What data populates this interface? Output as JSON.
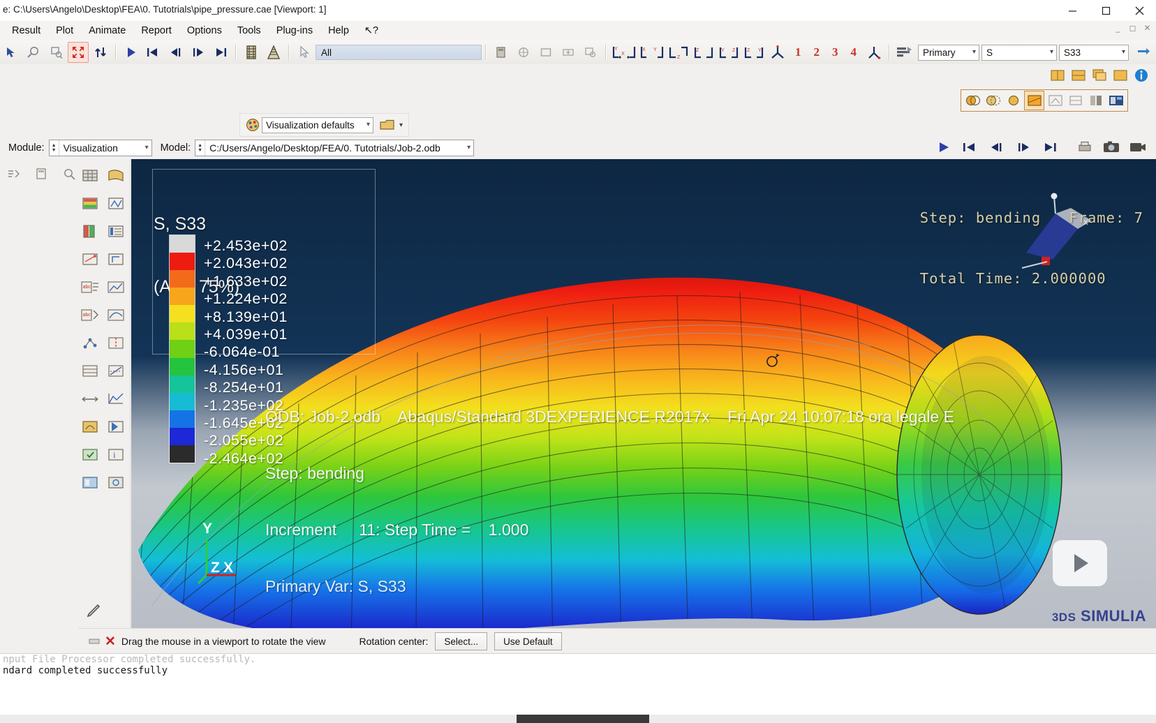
{
  "window": {
    "title": "e: C:\\Users\\Angelo\\Desktop\\FEA\\0. Tutotrials\\pipe_pressure.cae [Viewport: 1]",
    "minimize": "minimize-icon",
    "maximize": "maximize-icon",
    "close": "close-icon"
  },
  "menu": {
    "items": [
      {
        "label": "Result",
        "name": "menu-result"
      },
      {
        "label": "Plot",
        "name": "menu-plot"
      },
      {
        "label": "Animate",
        "name": "menu-animate"
      },
      {
        "label": "Report",
        "name": "menu-report"
      },
      {
        "label": "Options",
        "name": "menu-options"
      },
      {
        "label": "Tools",
        "name": "menu-tools"
      },
      {
        "label": "Plug-ins",
        "name": "menu-plugins"
      },
      {
        "label": "Help",
        "name": "menu-help"
      },
      {
        "label": "↖?",
        "name": "menu-context-help"
      }
    ]
  },
  "toolbar": {
    "all_selector": "All",
    "number_buttons": [
      "1",
      "2",
      "3",
      "4"
    ],
    "field_output": {
      "position": "Primary",
      "variable": "S",
      "component": "S33"
    }
  },
  "viz_bar": {
    "defaults": "Visualization defaults"
  },
  "context_bar": {
    "module_label": "Module:",
    "module_value": "Visualization",
    "model_label": "Model:",
    "model_value": "C:/Users/Angelo/Desktop/FEA/0. Tutotrials/Job-2.odb"
  },
  "viewport": {
    "legend": {
      "title_line1": "S, S33",
      "title_line2": "(Avg: 75%)",
      "values": [
        "+2.453e+02",
        "+2.043e+02",
        "+1.633e+02",
        "+1.224e+02",
        "+8.139e+01",
        "+4.039e+01",
        "-6.064e-01",
        "-4.156e+01",
        "-8.254e+01",
        "-1.235e+02",
        "-1.645e+02",
        "-2.055e+02",
        "-2.464e+02"
      ],
      "colors": [
        "#d9d9d9",
        "#ee1b11",
        "#f36a18",
        "#f7a61c",
        "#f4e01f",
        "#b9e018",
        "#6fd016",
        "#24c43f",
        "#16c49a",
        "#15bcd4",
        "#1573e6",
        "#1d28d6",
        "#2b2b2b"
      ]
    },
    "step_info_line1": "Step: bending   Frame: 7",
    "step_info_line2": "Total Time: 2.000000",
    "annotation": [
      "ODB: Job-2.odb    Abaqus/Standard 3DEXPERIENCE R2017x    Fri Apr 24 10:07:18 ora legale E",
      "Step: bending",
      "Increment     11: Step Time =    1.000",
      "Primary Var: S, S33"
    ],
    "triad_labels": {
      "y": "Y",
      "z": "Z",
      "x": "X"
    },
    "watermark": "SIMULIA",
    "play_badge": "play-badge-icon"
  },
  "prompt_bar": {
    "cancel": "cancel-icon",
    "message": "Drag the mouse in a viewport to rotate the view",
    "rotation_center_label": "Rotation center:",
    "select_button": "Select...",
    "use_default_button": "Use Default"
  },
  "message_area": {
    "lines": [
      "nput File Processor completed successfully.",
      "ndard completed successfully"
    ]
  },
  "chart_data": {
    "type": "heatmap",
    "title": "S, S33 (Avg: 75%)",
    "legend_values": [
      245.3,
      204.3,
      163.3,
      122.4,
      81.39,
      40.39,
      -0.6064,
      -41.56,
      -82.54,
      -123.5,
      -164.5,
      -205.5,
      -246.4
    ],
    "units_exponent": "e+02 / e+01",
    "max": 245.3,
    "min": -246.4,
    "variable": "S33",
    "step": "bending",
    "frame": 7,
    "total_time": 2.0
  }
}
